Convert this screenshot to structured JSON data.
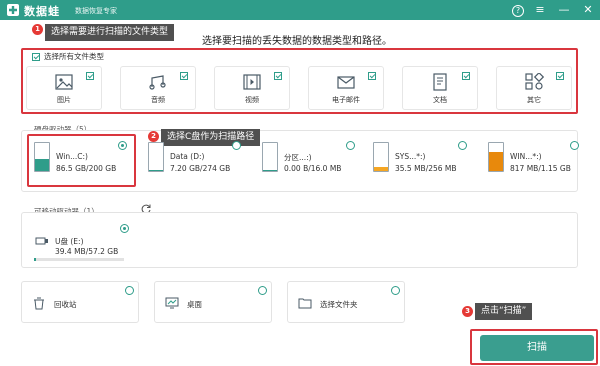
{
  "app": {
    "name": "数据蛙",
    "subtitle": "数据恢复专家",
    "help_icon": "help-circle-icon",
    "brand_color": "#2f9d8a"
  },
  "instruction": "选择要扫描的丢失数据的数据类型和路径。",
  "annotations": {
    "step1": {
      "num": "1",
      "text": "选择需要进行扫描的文件类型"
    },
    "step2": {
      "num": "2",
      "text": "选择C盘作为扫描路径"
    },
    "step3": {
      "num": "3",
      "text": "点击“扫描”"
    }
  },
  "file_types": {
    "select_all_label": "选择所有文件类型",
    "items": [
      {
        "label": "图片",
        "icon": "image-icon",
        "checked": true
      },
      {
        "label": "音频",
        "icon": "audio-icon",
        "checked": true
      },
      {
        "label": "视频",
        "icon": "video-icon",
        "checked": true
      },
      {
        "label": "电子邮件",
        "icon": "email-icon",
        "checked": true
      },
      {
        "label": "文档",
        "icon": "document-icon",
        "checked": true
      },
      {
        "label": "其它",
        "icon": "other-icon",
        "checked": true
      }
    ]
  },
  "hard_drives": {
    "title": "硬盘驱动器（5）",
    "items": [
      {
        "name": "Win...C:)",
        "size": "86.5 GB/200 GB",
        "fill_color": "#2f9d8a",
        "used_fraction": 0.43,
        "selected": true
      },
      {
        "name": "Data (D:)",
        "size": "7.20 GB/274 GB",
        "fill_color": "#2f9d8a",
        "used_fraction": 0.03,
        "selected": false
      },
      {
        "name": "分区...:)",
        "size": "0.00  B/16.0 MB",
        "fill_color": "#2f9d8a",
        "used_fraction": 0.0,
        "selected": false
      },
      {
        "name": "SYS...*:)",
        "size": "35.5 MB/256 MB",
        "fill_color": "#f5a623",
        "used_fraction": 0.14,
        "selected": false
      },
      {
        "name": "WIN...*:)",
        "size": "817 MB/1.15 GB",
        "fill_color": "#e8890c",
        "used_fraction": 0.69,
        "selected": false
      }
    ]
  },
  "removable_drives": {
    "title": "可移动驱动器（1）",
    "refresh_icon": "refresh-icon",
    "items": [
      {
        "name": "U盘 (E:)",
        "size": "39.4 MB/57.2 GB",
        "used_fraction": 0.001,
        "selected": true
      }
    ]
  },
  "locations": [
    {
      "label": "回收站",
      "icon": "recycle-bin-icon"
    },
    {
      "label": "桌面",
      "icon": "desktop-icon"
    },
    {
      "label": "选择文件夹",
      "icon": "folder-icon"
    }
  ],
  "scan_button": "扫描"
}
